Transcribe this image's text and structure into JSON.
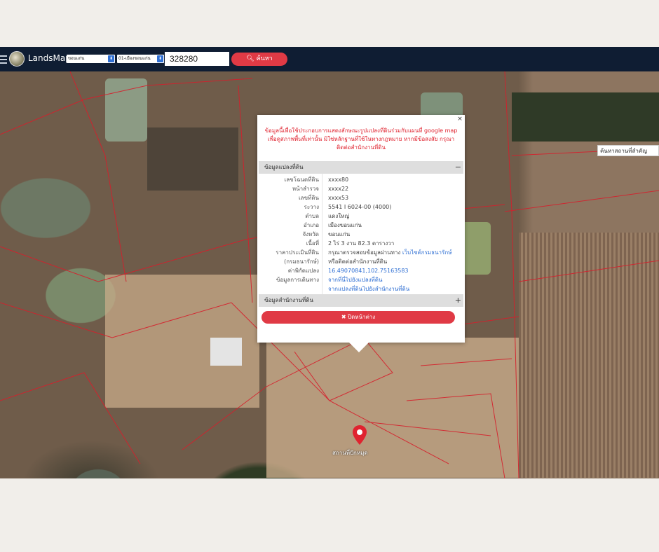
{
  "header": {
    "brand": "LandsMaps",
    "province_select": "ขอนแก่น",
    "district_select": "01-เมืองขอนแก่น",
    "search_value": "328280",
    "search_button": "ค้นหา",
    "search_icon": "search-icon",
    "background_color": "#0f1d33",
    "accent_color": "#e03a45"
  },
  "map": {
    "quick_link": "ค้นหาสถานที่สำคัญ",
    "marker_label": "สถานที่ปักหมุด"
  },
  "popup": {
    "disclaimer_lines": [
      "ข้อมูลนี้เพื่อใช้ประกอบการแสดงลักษณะรูปแปลงที่ดินร่วมกับแผนที่ google map",
      "เพื่อดูสภาพพื้นที่เท่านั้น มิใช่หลักฐานที่ใช้ในทางกฎหมาย หากมีข้อสงสัย กรุณา",
      "ติดต่อสำนักงานที่ดิน"
    ],
    "section_land": "ข้อมูลแปลงที่ดิน",
    "section_office": "ข้อมูลสำนักงานที่ดิน",
    "collapse_symbol": "−",
    "expand_symbol": "+",
    "rows": [
      {
        "label": "เลขโฉนดที่ดิน",
        "value": "xxxx80"
      },
      {
        "label": "หน้าสำรวจ",
        "value": "xxxx22"
      },
      {
        "label": "เลขที่ดิน",
        "value": "xxxx53"
      },
      {
        "label": "ระวาง",
        "value": "5541 I 6024-00 (4000)"
      },
      {
        "label": "ตำบล",
        "value": "แดงใหญ่"
      },
      {
        "label": "อำเภอ",
        "value": "เมืองขอนแก่น"
      },
      {
        "label": "จังหวัด",
        "value": "ขอนแก่น"
      },
      {
        "label": "เนื้อที่",
        "value": "2 ไร่ 3 งาน 82.3 ตารางวา"
      }
    ],
    "price_label_1": "ราคาประเมินที่ดิน",
    "price_label_2": "(กรมธนารักษ์)",
    "price_value_1": "กรุณาตรวจสอบข้อมูลผ่านทาง",
    "price_link": "เว็บไซต์กรมธนารักษ์",
    "price_value_2": "หรือติดต่อสำนักงานที่ดิน",
    "coord_label": "ค่าพิกัดแปลง",
    "coord_value": "16.49070841,102.75163583",
    "travel_label": "ข้อมูลการเดินทาง",
    "travel_link_1": "จากที่นี่ไปยังแปลงที่ดิน",
    "travel_link_2": "จากแปลงที่ดินไปยังสำนักงานที่ดิน",
    "close_button": "✖ ปิดหน้าต่าง",
    "close_icon": "×"
  }
}
